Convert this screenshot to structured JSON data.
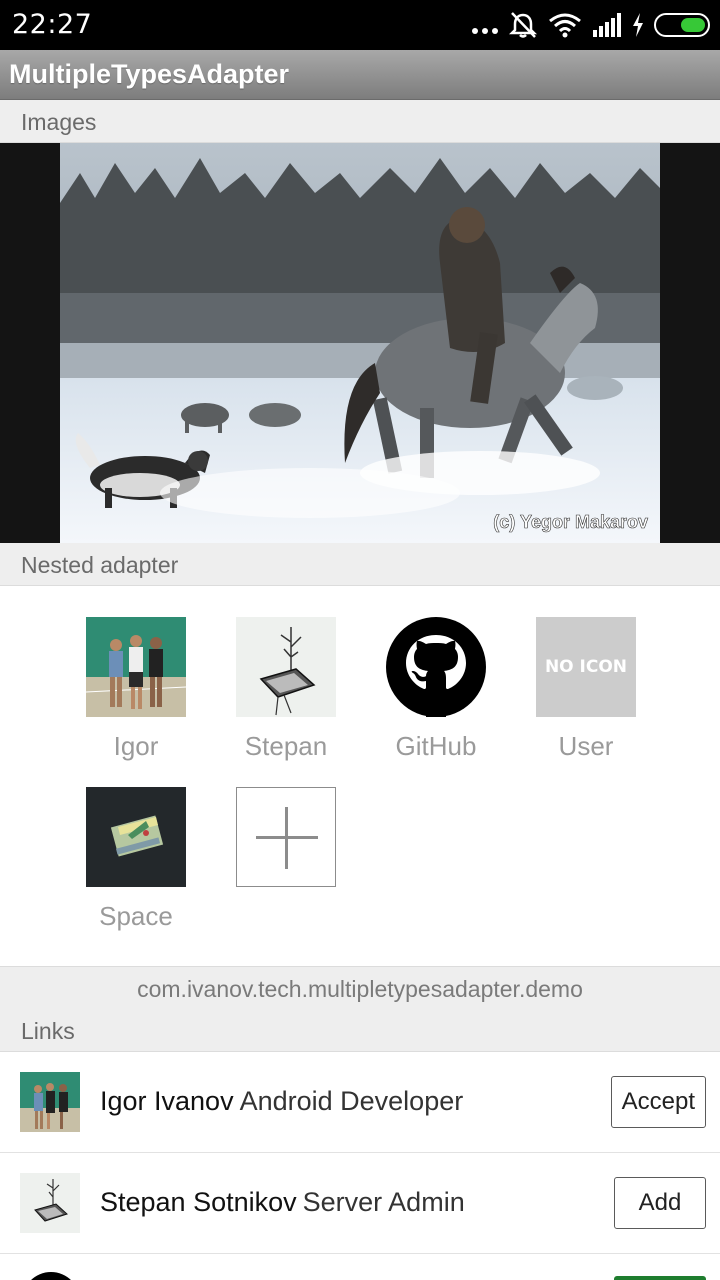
{
  "status_bar": {
    "time": "22:27",
    "icons": [
      "more-dots-icon",
      "mute-bell-icon",
      "wifi-icon",
      "signal-icon",
      "charging-bolt-icon",
      "battery-icon"
    ],
    "battery_color": "#37c837"
  },
  "app_bar": {
    "title": "MultipleTypesAdapter"
  },
  "sections": {
    "images": "Images",
    "nested": "Nested adapter",
    "links": "Links"
  },
  "image": {
    "watermark": "(c) Yegor Makarov"
  },
  "nested_items": [
    {
      "label": "Igor",
      "icon": "photo-thumbnail"
    },
    {
      "label": "Stepan",
      "icon": "sketch-thumbnail"
    },
    {
      "label": "GitHub",
      "icon": "github-icon"
    },
    {
      "label": "User",
      "icon": "no-icon-placeholder",
      "placeholder_text": "NO ICON"
    },
    {
      "label": "Space",
      "icon": "badge-thumbnail"
    },
    {
      "label": "",
      "icon": "plus-icon"
    }
  ],
  "package_name": "com.ivanov.tech.multipletypesadapter.demo",
  "links": [
    {
      "name": "Igor Ivanov",
      "role": "Android Developer",
      "action": "Accept"
    },
    {
      "name": "Stepan Sotnikov",
      "role": "Server Admin",
      "action": "Add"
    }
  ],
  "colors": {
    "appbar": "#8f8f8f",
    "section_bg": "#eeeeee",
    "action_green": "#1e7d2e"
  }
}
